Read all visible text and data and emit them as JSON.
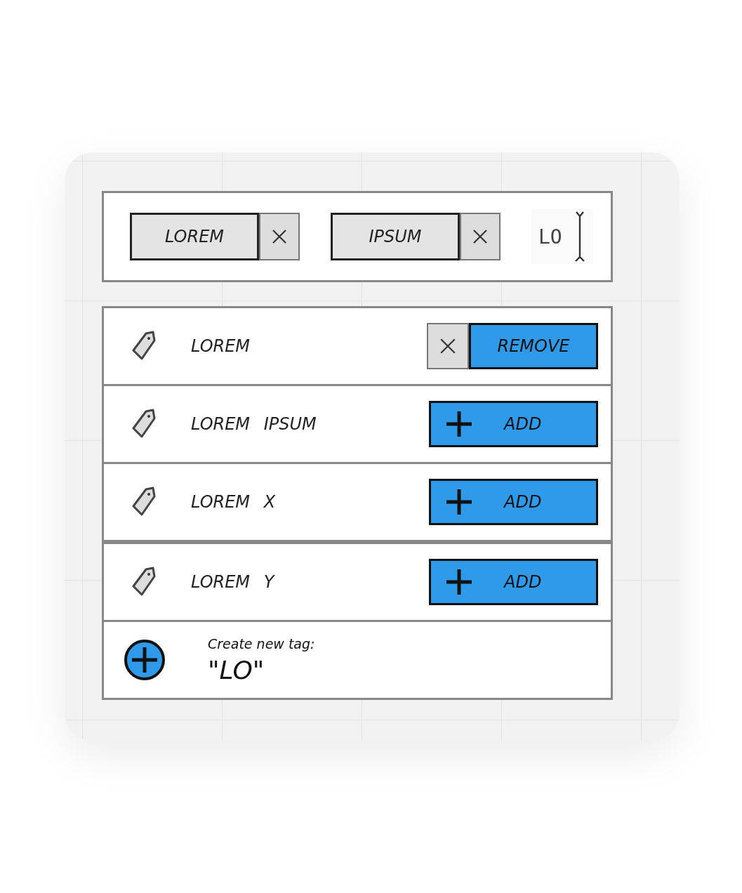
{
  "selected_tags": [
    {
      "label": "LOREM"
    },
    {
      "label": "IPSUM"
    }
  ],
  "tag_input": {
    "value": "LO"
  },
  "suggestions": [
    {
      "label": "LOREM",
      "selected": true,
      "action": "REMOVE"
    },
    {
      "label": "LOREM IPSUM",
      "selected": false,
      "action": "ADD"
    },
    {
      "label": "LOREM X",
      "selected": false,
      "action": "ADD"
    },
    {
      "label": "LOREM Y",
      "selected": false,
      "action": "ADD"
    }
  ],
  "create": {
    "label": "Create new tag:",
    "value": "\"LO\""
  }
}
